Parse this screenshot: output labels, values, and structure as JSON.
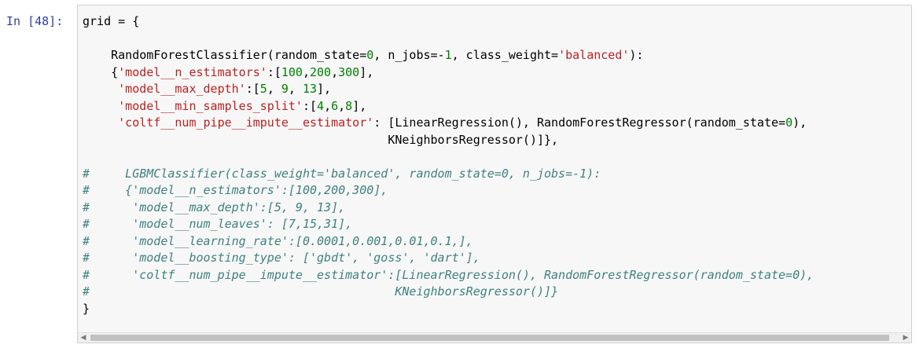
{
  "cell": {
    "prompt": "In [48]:",
    "lines": [
      [
        {
          "t": "o",
          "v": "grid = {"
        }
      ],
      [
        {
          "t": "o",
          "v": ""
        }
      ],
      [
        {
          "t": "o",
          "v": "    RandomForestClassifier(random_state="
        },
        {
          "t": "n",
          "v": "0"
        },
        {
          "t": "o",
          "v": ", n_jobs=-"
        },
        {
          "t": "n",
          "v": "1"
        },
        {
          "t": "o",
          "v": ", class_weight="
        },
        {
          "t": "s",
          "v": "'balanced'"
        },
        {
          "t": "o",
          "v": "):"
        }
      ],
      [
        {
          "t": "o",
          "v": "    {"
        },
        {
          "t": "s",
          "v": "'model__n_estimators'"
        },
        {
          "t": "o",
          "v": ":["
        },
        {
          "t": "n",
          "v": "100"
        },
        {
          "t": "o",
          "v": ","
        },
        {
          "t": "n",
          "v": "200"
        },
        {
          "t": "o",
          "v": ","
        },
        {
          "t": "n",
          "v": "300"
        },
        {
          "t": "o",
          "v": "],"
        }
      ],
      [
        {
          "t": "o",
          "v": "     "
        },
        {
          "t": "s",
          "v": "'model__max_depth'"
        },
        {
          "t": "o",
          "v": ":["
        },
        {
          "t": "n",
          "v": "5"
        },
        {
          "t": "o",
          "v": ", "
        },
        {
          "t": "n",
          "v": "9"
        },
        {
          "t": "o",
          "v": ", "
        },
        {
          "t": "n",
          "v": "13"
        },
        {
          "t": "o",
          "v": "],"
        }
      ],
      [
        {
          "t": "o",
          "v": "     "
        },
        {
          "t": "s",
          "v": "'model__min_samples_split'"
        },
        {
          "t": "o",
          "v": ":["
        },
        {
          "t": "n",
          "v": "4"
        },
        {
          "t": "o",
          "v": ","
        },
        {
          "t": "n",
          "v": "6"
        },
        {
          "t": "o",
          "v": ","
        },
        {
          "t": "n",
          "v": "8"
        },
        {
          "t": "o",
          "v": "],"
        }
      ],
      [
        {
          "t": "o",
          "v": "     "
        },
        {
          "t": "s",
          "v": "'coltf__num_pipe__impute__estimator'"
        },
        {
          "t": "o",
          "v": ": [LinearRegression(), RandomForestRegressor(random_state="
        },
        {
          "t": "n",
          "v": "0"
        },
        {
          "t": "o",
          "v": "),"
        }
      ],
      [
        {
          "t": "o",
          "v": "                                           KNeighborsRegressor()]},"
        }
      ],
      [
        {
          "t": "o",
          "v": ""
        }
      ],
      [
        {
          "t": "c",
          "v": "#     LGBMClassifier(class_weight='balanced', random_state=0, n_jobs=-1):"
        }
      ],
      [
        {
          "t": "c",
          "v": "#     {'model__n_estimators':[100,200,300],"
        }
      ],
      [
        {
          "t": "c",
          "v": "#      'model__max_depth':[5, 9, 13],"
        }
      ],
      [
        {
          "t": "c",
          "v": "#      'model__num_leaves': [7,15,31],"
        }
      ],
      [
        {
          "t": "c",
          "v": "#      'model__learning_rate':[0.0001,0.001,0.01,0.1,],"
        }
      ],
      [
        {
          "t": "c",
          "v": "#      'model__boosting_type': ['gbdt', 'goss', 'dart'],"
        }
      ],
      [
        {
          "t": "c",
          "v": "#      'coltf__num_pipe__impute__estimator':[LinearRegression(), RandomForestRegressor(random_state=0),"
        }
      ],
      [
        {
          "t": "c",
          "v": "#                                           KNeighborsRegressor()]}"
        }
      ],
      [
        {
          "t": "o",
          "v": "}"
        }
      ]
    ]
  },
  "scrollbar": {
    "left_arrow": "◀",
    "right_arrow": "▶"
  },
  "colors": {
    "prompt": "#303f9f",
    "string": "#ba2121",
    "number": "#008000",
    "comment": "#408080",
    "editor_bg": "#f7f7f7"
  }
}
